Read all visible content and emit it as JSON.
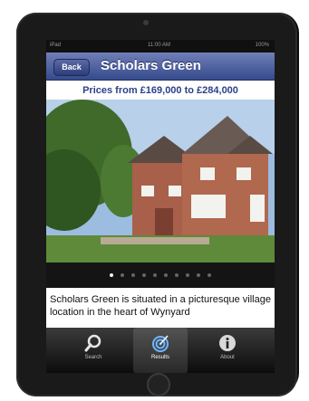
{
  "status_bar": {
    "carrier": "iPad",
    "time": "11:00 AM",
    "battery": "100%"
  },
  "nav": {
    "back_label": "Back",
    "title": "Scholars Green"
  },
  "price_header": "Prices from £169,000 to £284,000",
  "gallery": {
    "image_count": 10,
    "current_index": 0
  },
  "description": "Scholars Green is situated in a picturesque village location in the heart of Wynyard",
  "tabs": [
    {
      "label": "Search",
      "icon": "magnifier-icon",
      "selected": false
    },
    {
      "label": "Results",
      "icon": "target-icon",
      "selected": true
    },
    {
      "label": "About",
      "icon": "info-icon",
      "selected": false
    }
  ],
  "colors": {
    "nav_bar": "#364a8c",
    "price_text": "#2e3f8a",
    "tab_bar": "#0c0c0c"
  }
}
